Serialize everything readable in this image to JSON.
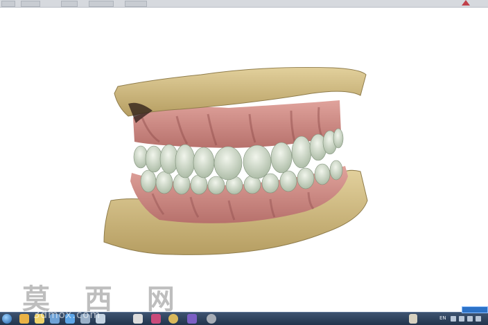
{
  "watermark": {
    "text": "莫 西 网",
    "url": "3dmox.com"
  },
  "taskbar": {
    "apps": [
      "start",
      "explorer",
      "media",
      "folder",
      "app",
      "app",
      "app",
      "cad",
      "ball",
      "search",
      "browser"
    ],
    "tray_lang": "EN"
  },
  "colors": {
    "stone": "#d9c48e",
    "gum": "#d08c86",
    "tooth": "#c9d6c0",
    "taskbar": "#2c3f58"
  }
}
